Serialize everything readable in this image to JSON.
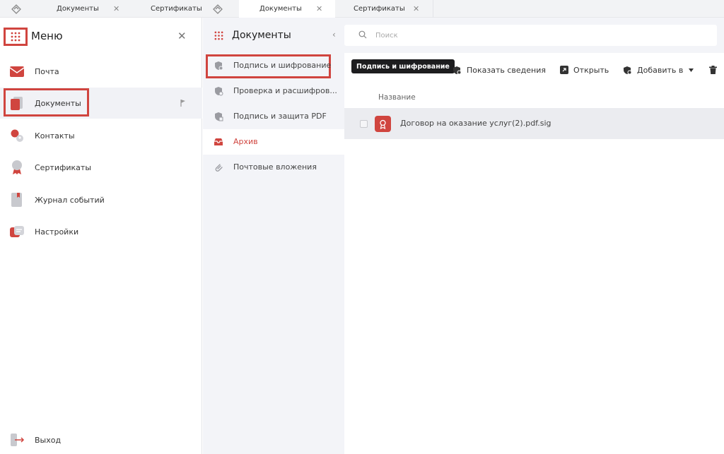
{
  "tabs": [
    {
      "label": "Документы",
      "close": "✕"
    },
    {
      "label": "Сертификаты"
    },
    {
      "label": "Документы",
      "close": "✕"
    },
    {
      "label": "Сертификаты",
      "close": "✕"
    }
  ],
  "menu": {
    "title": "Меню",
    "close": "✕",
    "items": [
      {
        "label": "Почта",
        "icon": "mail-icon"
      },
      {
        "label": "Документы",
        "icon": "documents-icon"
      },
      {
        "label": "Контакты",
        "icon": "contacts-icon"
      },
      {
        "label": "Сертификаты",
        "icon": "certificate-icon"
      },
      {
        "label": "Журнал событий",
        "icon": "journal-icon"
      },
      {
        "label": "Настройки",
        "icon": "settings-icon"
      }
    ],
    "logout": "Выход"
  },
  "submenu": {
    "title": "Документы",
    "collapse": "‹",
    "items": [
      {
        "label": "Подпись и шифрование"
      },
      {
        "label": "Проверка и расшифров..."
      },
      {
        "label": "Подпись и защита PDF"
      },
      {
        "label": "Архив"
      },
      {
        "label": "Почтовые вложения"
      }
    ]
  },
  "search": {
    "placeholder": "Поиск"
  },
  "toolbar": {
    "tooltip": "Подпись и шифрование",
    "show_info": "Показать сведения",
    "open": "Открыть",
    "add_to": "Добавить в"
  },
  "table": {
    "column_name": "Название",
    "rows": [
      {
        "name": "Договор на оказание услуг(2).pdf.sig"
      }
    ]
  },
  "colors": {
    "accent": "#d0453f",
    "panel_bg": "#f3f4f8",
    "tooltip_bg": "#1d1d1f"
  }
}
